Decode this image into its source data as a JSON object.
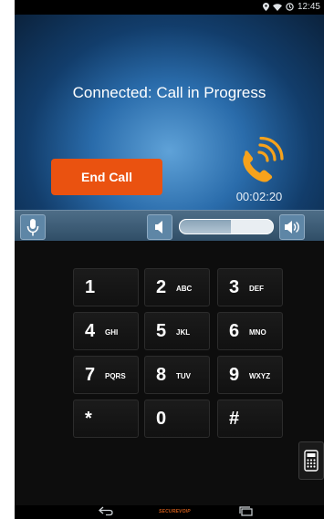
{
  "status_bar": {
    "time": "12:45"
  },
  "call": {
    "status_text": "Connected: Call in Progress",
    "end_button_label": "End Call",
    "timer": "00:02:20"
  },
  "volume": {
    "level_fraction": 0.55
  },
  "keypad": {
    "keys": [
      {
        "digit": "1",
        "letters": ""
      },
      {
        "digit": "2",
        "letters": "ABC"
      },
      {
        "digit": "3",
        "letters": "DEF"
      },
      {
        "digit": "4",
        "letters": "GHI"
      },
      {
        "digit": "5",
        "letters": "JKL"
      },
      {
        "digit": "6",
        "letters": "MNO"
      },
      {
        "digit": "7",
        "letters": "PQRS"
      },
      {
        "digit": "8",
        "letters": "TUV"
      },
      {
        "digit": "9",
        "letters": "WXYZ"
      },
      {
        "digit": "*",
        "letters": ""
      },
      {
        "digit": "0",
        "letters": ""
      },
      {
        "digit": "#",
        "letters": ""
      }
    ]
  },
  "nav_bar": {
    "logo_text": "SECUREVOIP"
  },
  "colors": {
    "end_call": "#ea5210",
    "phone_icon": "#f6a21c"
  },
  "icons": [
    "location-icon",
    "wifi-icon",
    "sync-icon",
    "phone-ringing-icon",
    "microphone-icon",
    "speaker-low-icon",
    "speaker-high-icon",
    "dialpad-icon",
    "back-icon",
    "recent-apps-icon"
  ]
}
